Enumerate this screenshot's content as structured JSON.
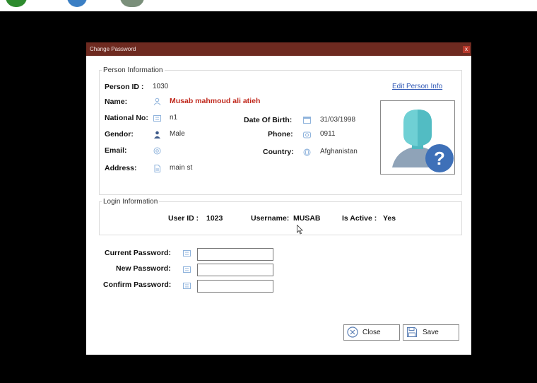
{
  "window": {
    "title": "Change Password",
    "close_glyph": "x"
  },
  "person": {
    "legend": "Person Information",
    "edit_link": "Edit Person Info",
    "person_id_label": "Person ID :",
    "person_id": "1030",
    "name_label": "Name:",
    "name": "Musab mahmoud ali atieh",
    "national_no_label": "National No:",
    "national_no": "n1",
    "gender_label": "Gendor:",
    "gender": "Male",
    "email_label": "Email:",
    "email": "",
    "address_label": "Address:",
    "address": "main st",
    "dob_label": "Date Of Birth:",
    "dob": "31/03/1998",
    "phone_label": "Phone:",
    "phone": "0911",
    "country_label": "Country:",
    "country": "Afghanistan"
  },
  "login": {
    "legend": "Login Information",
    "user_id_label": "User ID :",
    "user_id": "1023",
    "username_label": "Username:",
    "username": "MUSAB",
    "is_active_label": "Is Active :",
    "is_active": "Yes"
  },
  "passwords": {
    "current_label": "Current Password:",
    "new_label": "New Password:",
    "confirm_label": "Confirm Password:",
    "current_value": "",
    "new_value": "",
    "confirm_value": ""
  },
  "buttons": {
    "close": "Close",
    "save": "Save"
  },
  "colors": {
    "titlebar": "#6e2a20",
    "name_text": "#c0281c",
    "link": "#2f57b5",
    "icon": "#8fb3dc"
  }
}
